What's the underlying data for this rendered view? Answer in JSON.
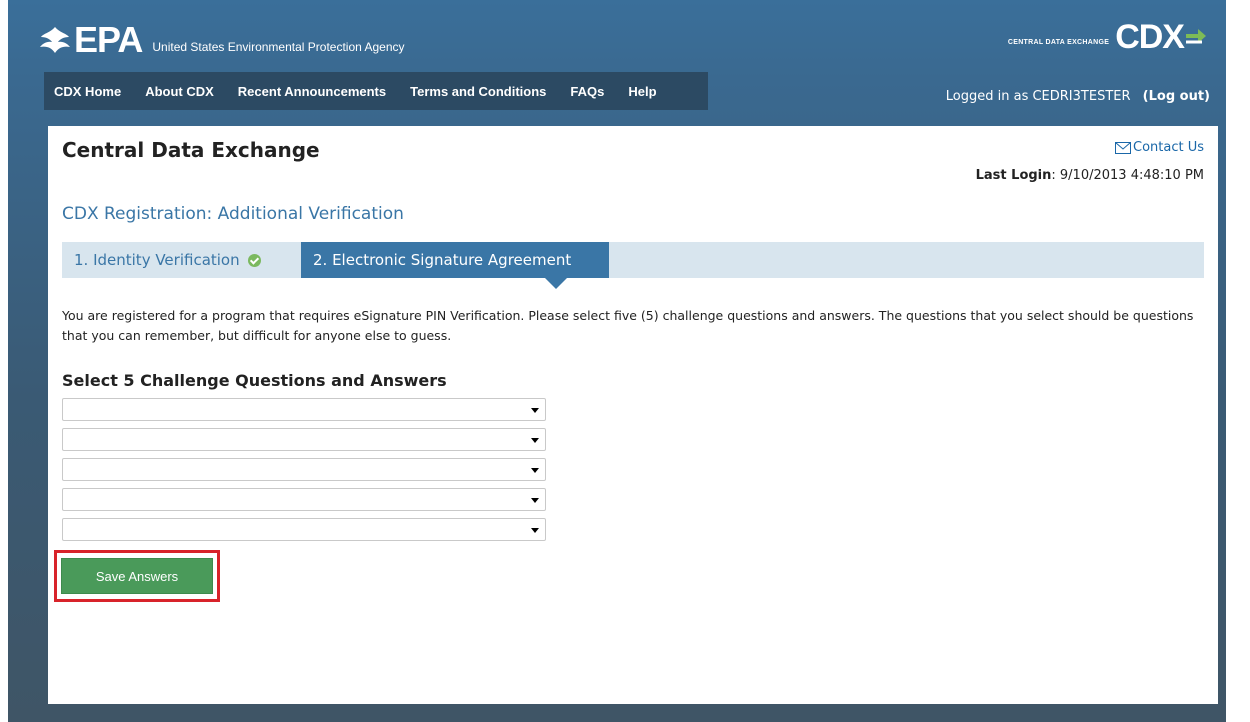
{
  "header": {
    "logo_text": "EPA",
    "agency_name": "United States Environmental Protection Agency",
    "cdx_tagline": "CENTRAL DATA EXCHANGE",
    "cdx_logo_text": "CDX"
  },
  "nav": {
    "items": [
      "CDX Home",
      "About CDX",
      "Recent Announcements",
      "Terms and Conditions",
      "FAQs",
      "Help"
    ]
  },
  "user": {
    "logged_in_text": "Logged in as CEDRI3TESTER",
    "logout_label": "(Log out)"
  },
  "page": {
    "title": "Central Data Exchange",
    "contact_label": "Contact Us",
    "last_login_label": "Last Login",
    "last_login_value": ": 9/10/2013 4:48:10 PM",
    "registration_title": "CDX Registration: Additional Verification",
    "steps": [
      {
        "label": "1. Identity Verification",
        "status": "complete"
      },
      {
        "label": "2. Electronic Signature Agreement",
        "status": "active"
      }
    ],
    "intro": "You are registered for a program that requires eSignature PIN Verification. Please select five (5) challenge questions and answers. The questions that you select should be questions that you can remember, but difficult for anyone else to guess.",
    "questions_heading": "Select 5 Challenge Questions and Answers",
    "question_selects": [
      "",
      "",
      "",
      "",
      ""
    ],
    "save_label": "Save Answers"
  },
  "colors": {
    "accent": "#3a76a6",
    "save_button": "#4a9a5a",
    "highlight": "#d8232a"
  }
}
